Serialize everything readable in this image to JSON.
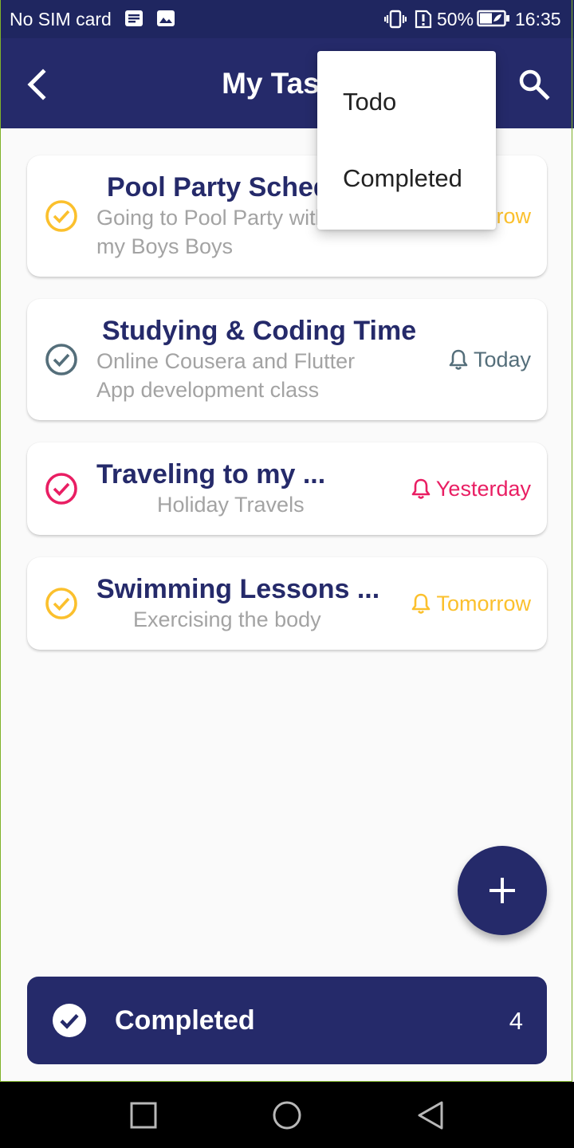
{
  "status_bar": {
    "carrier": "No SIM card",
    "battery": "50%",
    "time": "16:35",
    "icons": [
      "message-icon",
      "image-icon",
      "vibrate-icon",
      "alert-icon",
      "battery-icon"
    ]
  },
  "app_bar": {
    "title": "My Tasks",
    "back_icon": "chevron-left-icon",
    "search_icon": "search-icon"
  },
  "menu": {
    "items": [
      "Todo",
      "Completed"
    ]
  },
  "tasks": [
    {
      "title": "Pool Party Schedule",
      "subtitle_line1": "Going to Pool Party with",
      "subtitle_line2": "my Boys Boys",
      "reminder": "Tomorrow",
      "color": "#fbc02d"
    },
    {
      "title": "Studying & Coding Time",
      "subtitle_line1": "Online Cousera and Flutter",
      "subtitle_line2": "App development class",
      "reminder": "Today",
      "color": "#546e7a"
    },
    {
      "title": "Traveling to my ...",
      "subtitle_line1": "Holiday Travels",
      "reminder": "Yesterday",
      "color": "#e91e63"
    },
    {
      "title": "Swimming Lessons ...",
      "subtitle_line1": "Exercising the body",
      "reminder": "Tomorrow",
      "color": "#fbc02d"
    }
  ],
  "fab": {
    "icon": "plus-icon"
  },
  "completed_bar": {
    "label": "Completed",
    "count": "4",
    "icon": "check-circle-icon"
  },
  "colors": {
    "primary": "#252a6a",
    "status_bar": "#1f2660",
    "yellow": "#fbc02d",
    "slate": "#546e7a",
    "pink": "#e91e63"
  }
}
